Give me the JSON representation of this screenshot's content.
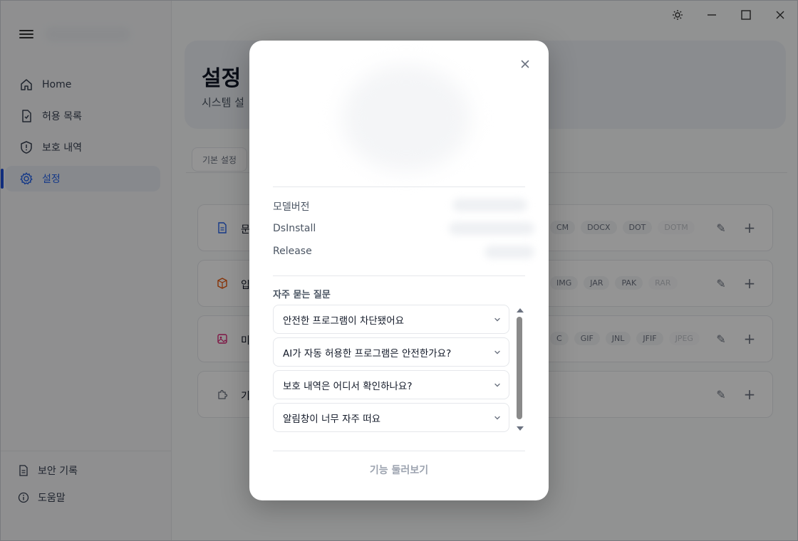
{
  "sidebar": {
    "items": [
      {
        "label": "Home",
        "icon": "home-icon"
      },
      {
        "label": "허용 목록",
        "icon": "file-check-icon"
      },
      {
        "label": "보호 내역",
        "icon": "shield-icon"
      },
      {
        "label": "설정",
        "icon": "gear-icon",
        "active": true
      }
    ],
    "bottom": [
      {
        "label": "보안 기록",
        "icon": "document-icon"
      },
      {
        "label": "도움말",
        "icon": "info-icon"
      }
    ]
  },
  "main": {
    "title": "설정",
    "subtitle": "시스템 설",
    "tab": "기본 설정",
    "rows": [
      {
        "title": "문",
        "icon": "document-icon",
        "color": "#2563eb",
        "chips": [
          "CM",
          "DOCX",
          "DOT",
          "DOTM"
        ]
      },
      {
        "title": "입",
        "icon": "package-icon",
        "color": "#ea580c",
        "chips": [
          "IMG",
          "JAR",
          "PAK",
          "RAR"
        ]
      },
      {
        "title": "미",
        "icon": "image-icon",
        "color": "#db2777",
        "chips": [
          "C",
          "GIF",
          "JNL",
          "JFIF",
          "JPEG"
        ]
      },
      {
        "title": "기",
        "icon": "puzzle-icon",
        "color": "#6b7280",
        "chips": []
      }
    ]
  },
  "modal": {
    "info": [
      {
        "label": "모델버전"
      },
      {
        "label": "DsInstall"
      },
      {
        "label": "Release"
      }
    ],
    "faq_title": "자주 묻는 질문",
    "faq": [
      "안전한 프로그램이 차단됐어요",
      "AI가 자동 허용한 프로그램은 안전한가요?",
      "보호 내역은 어디서 확인하나요?",
      "알림창이 너무 자주 떠요"
    ],
    "tour_label": "기능 둘러보기"
  },
  "colors": {
    "accent": "#2563eb",
    "overlay": "rgba(0,0,0,0.42)"
  }
}
